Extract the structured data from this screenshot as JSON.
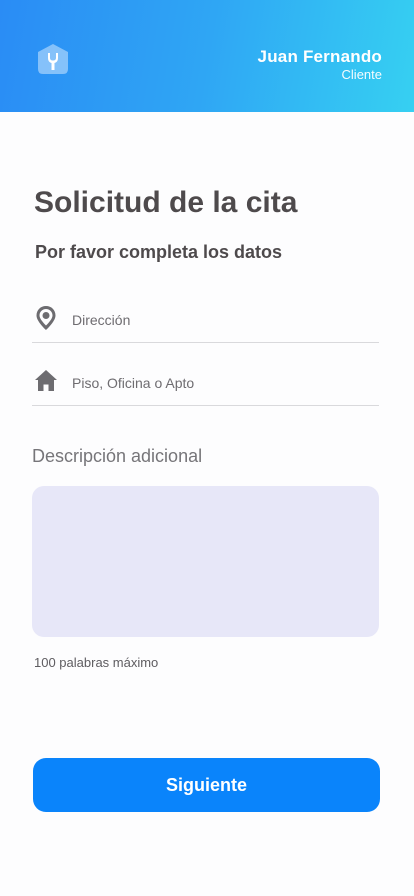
{
  "header": {
    "user_name": "Juan Fernando",
    "user_role": "Cliente",
    "logo_icon": "wrench-house-icon",
    "gradient_start": "#2a8cf5",
    "gradient_end": "#36d0f2"
  },
  "main": {
    "title": "Solicitud de la cita",
    "subtitle": "Por favor completa los datos",
    "address_field": {
      "placeholder": "Dirección",
      "value": "",
      "icon": "location-pin-icon"
    },
    "floor_field": {
      "placeholder": "Piso, Oficina o Apto",
      "value": "",
      "icon": "home-icon"
    },
    "description_label": "Descripción adicional",
    "description_value": "",
    "description_hint": "100 palabras máximo",
    "next_button": "Siguiente"
  },
  "colors": {
    "accent": "#0a84fb",
    "text_dark": "#4e4a4c",
    "textarea_bg": "#e7e7f8"
  }
}
